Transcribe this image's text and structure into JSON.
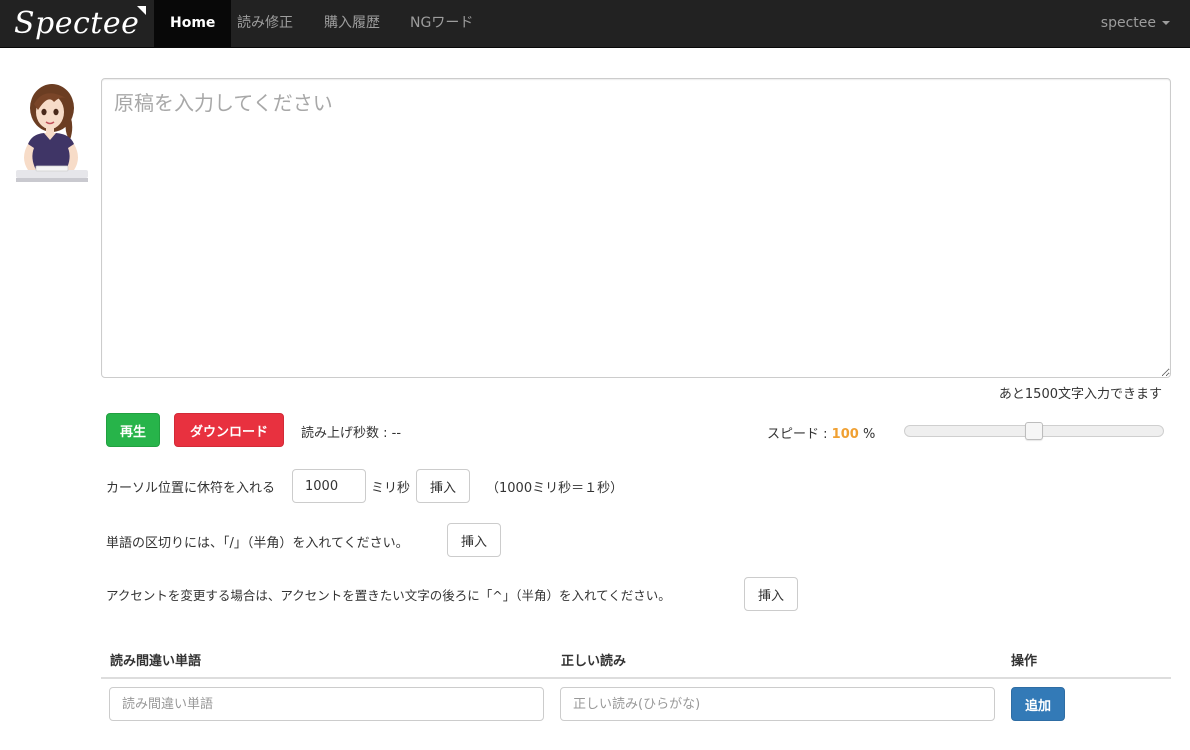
{
  "navbar": {
    "brand": "Spectee",
    "items": [
      {
        "label": "Home",
        "active": true
      },
      {
        "label": "読み修正",
        "active": false
      },
      {
        "label": "購入履歴",
        "active": false
      },
      {
        "label": "NGワード",
        "active": false
      }
    ],
    "user": "spectee",
    "user_icon": "caret-down-icon"
  },
  "editor": {
    "placeholder": "原稿を入力してください",
    "remaining": "あと1500文字入力できます"
  },
  "controls": {
    "play_label": "再生",
    "download_label": "ダウンロード",
    "read_seconds": "読み上げ秒数 : --",
    "speed_label": "スピード :",
    "speed_value": "100",
    "speed_unit": "%",
    "speed_level": 0.5
  },
  "pause_row": {
    "label": "カーソル位置に休符を入れる",
    "value": "1000",
    "unit": "ミリ秒",
    "insert_label": "挿入",
    "note": "（1000ミリ秒＝１秒）"
  },
  "word_break_row": {
    "label": "単語の区切りには、「/」（半角）を入れてください。",
    "insert_label": "挿入"
  },
  "accent_row": {
    "label": "アクセントを変更する場合は、アクセントを置きたい文字の後ろに「^」（半角）を入れてください。",
    "insert_label": "挿入"
  },
  "table": {
    "headers": [
      "読み間違い単語",
      "正しい読み",
      "操作"
    ],
    "wrong_word_placeholder": "読み間違い単語",
    "correct_reading_placeholder": "正しい読み(ひらがな)",
    "add_label": "追加"
  },
  "colors": {
    "navbar_bg": "#222222",
    "play": "#27b44a",
    "download": "#e8313f",
    "add": "#337ab7",
    "speed_value": "#f0a032"
  }
}
